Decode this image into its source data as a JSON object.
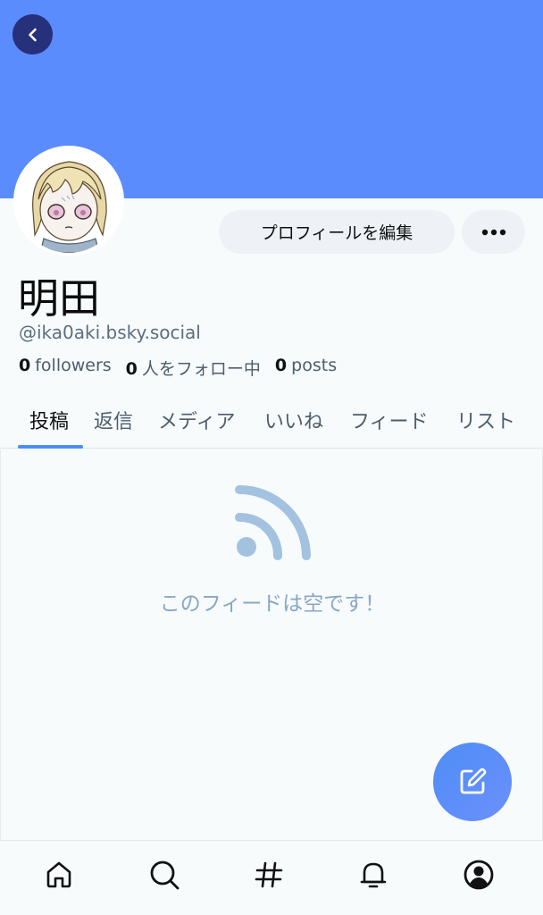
{
  "profile": {
    "display_name": "明田",
    "handle": "@ika0aki.bsky.social",
    "edit_label": "プロフィールを編集"
  },
  "stats": {
    "followers_count": "0",
    "followers_label": "followers",
    "following_count": "0",
    "following_label": "人をフォロー中",
    "posts_count": "0",
    "posts_label": "posts"
  },
  "tabs": [
    {
      "label": "投稿"
    },
    {
      "label": "返信"
    },
    {
      "label": "メディア"
    },
    {
      "label": "いいね"
    },
    {
      "label": "フィード"
    },
    {
      "label": "リスト"
    }
  ],
  "feed": {
    "empty_message": "このフィードは空です！"
  },
  "colors": {
    "banner": "#5b8cfe",
    "accent": "#4c8ef5",
    "back_button": "#27307a",
    "empty_icon": "#a3c2e0"
  },
  "icons": {
    "back": "chevron-left-icon",
    "more": "ellipsis-icon",
    "empty": "rss-icon",
    "compose": "compose-icon",
    "nav": [
      "home-icon",
      "search-icon",
      "hashtag-icon",
      "bell-icon",
      "user-icon"
    ]
  }
}
